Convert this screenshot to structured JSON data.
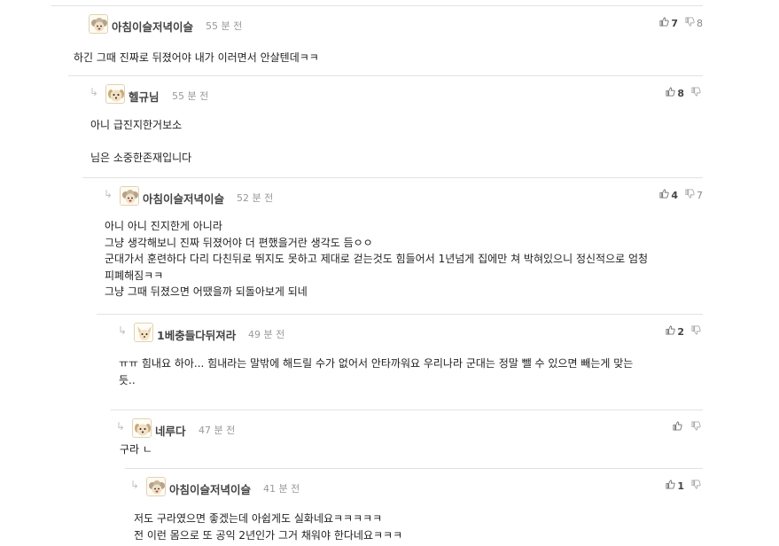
{
  "comments": [
    {
      "author": "아침이슬저녁이슬",
      "time": "55 분 전",
      "up": "7",
      "down": "8",
      "text": "하긴 그때 진짜로 뒤졌어야 내가 이러면서 안살텐데ㅋㅋ",
      "avatar": "poodle-icon"
    },
    {
      "author": "헬규님",
      "time": "55 분 전",
      "up": "8",
      "down": "",
      "text": "아니 급진지한거보소\n\n님은 소중한존재입니다",
      "avatar": "puppy-icon"
    },
    {
      "author": "아침이슬저녁이슬",
      "time": "52 분 전",
      "up": "4",
      "down": "7",
      "text": "아니 아니 진지한게 아니라\n그냥 생각해보니 진짜 뒤졌어야 더 편했을거란 생각도 듬ㅇㅇ\n군대가서 훈련하다 다리 다친뒤로 뛰지도 못하고 제대로 걷는것도 힘들어서 1년넘게 집에만 쳐 박혀있으니 정신적으로 엄청\n피폐해짐ㅋㅋ\n그냥 그때 뒤졌으면 어땠을까 되돌아보게 되네",
      "avatar": "poodle-icon"
    },
    {
      "author": "1베충들다뒤져라",
      "time": "49 분 전",
      "up": "2",
      "down": "",
      "text": "ㅠㅠ 힘내요 하아... 힘내라는 말밖에 해드릴 수가 없어서 안타까워요 우리나라 군대는 정말 뺄 수 있으면 빼는게 맞는\n듯..",
      "avatar": "chihuahua-icon"
    },
    {
      "author": "네루다",
      "time": "47 분 전",
      "up": "",
      "down": "",
      "text": "구라 ㄴ",
      "avatar": "puppy-icon"
    },
    {
      "author": "아침이슬저녁이슬",
      "time": "41 분 전",
      "up": "1",
      "down": "",
      "text": "저도 구라였으면 좋겠는데 아쉽게도 실화네요ㅋㅋㅋㅋㅋ\n전 이런 몸으로 또 공익 2년인가 그거 채워야 한다네요ㅋㅋㅋ",
      "avatar": "poodle-icon"
    }
  ],
  "icons": {
    "reply": "reply-arrow-icon",
    "upvote": "thumbs-up-icon",
    "downvote": "thumbs-down-icon"
  },
  "colors": {
    "divider": "#e2e2e2",
    "author": "#444444",
    "time": "#999999"
  }
}
